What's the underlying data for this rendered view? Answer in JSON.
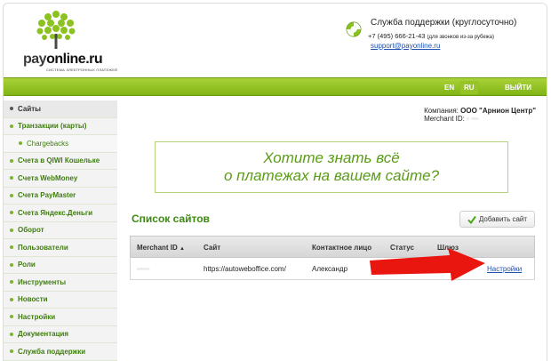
{
  "header": {
    "logo": {
      "pay": "pay",
      "online": "online.ru",
      "tagline": "СИСТЕМА ЭЛЕКТРОННЫХ ПЛАТЕЖЕЙ"
    },
    "support": {
      "title": "Служба поддержки (круглосуточно)",
      "phone": "+7 (495) 666-21-43",
      "phone_note": "(для звонков из-за рубежа)",
      "email": "support@payonline.ru",
      "icon": "lifebuoy-icon"
    }
  },
  "topbar": {
    "lang_en": "EN",
    "lang_ru": "RU",
    "logout": "ВЫЙТИ"
  },
  "sidebar": {
    "items": [
      {
        "label": "Сайты"
      },
      {
        "label": "Транзакции (карты)"
      },
      {
        "label": "Chargebacks"
      },
      {
        "label": "Счета в QIWI Кошельке"
      },
      {
        "label": "Счета WebMoney"
      },
      {
        "label": "Счета PayMaster"
      },
      {
        "label": "Счета Яндекс.Деньги"
      },
      {
        "label": "Оборот"
      },
      {
        "label": "Пользователи"
      },
      {
        "label": "Роли"
      },
      {
        "label": "Инструменты"
      },
      {
        "label": "Новости"
      },
      {
        "label": "Настройки"
      },
      {
        "label": "Документация"
      },
      {
        "label": "Служба поддержки"
      }
    ]
  },
  "company": {
    "label": "Компания:",
    "name": "ООО \"Арнион Центр\"",
    "merchant_label": "Merchant ID:",
    "merchant_value": "▫ ▫▫▫"
  },
  "banner": {
    "line1": "Хотите знать всё",
    "line2": "о платежах на вашем сайте?"
  },
  "sites": {
    "title": "Список сайтов",
    "add_button": "Добавить сайт",
    "columns": {
      "merchant_id": "Merchant ID",
      "sort_indicator": "▲",
      "site": "Сайт",
      "contact": "Контактное лицо",
      "status": "Статус",
      "gateway": "Шлюз"
    },
    "rows": [
      {
        "merchant_id": "▫▫▫▫▫",
        "site": "https://autoweboffice.com/",
        "contact": "Александр",
        "status": "",
        "gateway": "",
        "action": "Настройки"
      }
    ]
  },
  "colors": {
    "brand_green": "#8cc21f",
    "link_blue": "#1f4fb0",
    "arrow_red": "#e8160f",
    "title_green": "#3d8a12"
  }
}
